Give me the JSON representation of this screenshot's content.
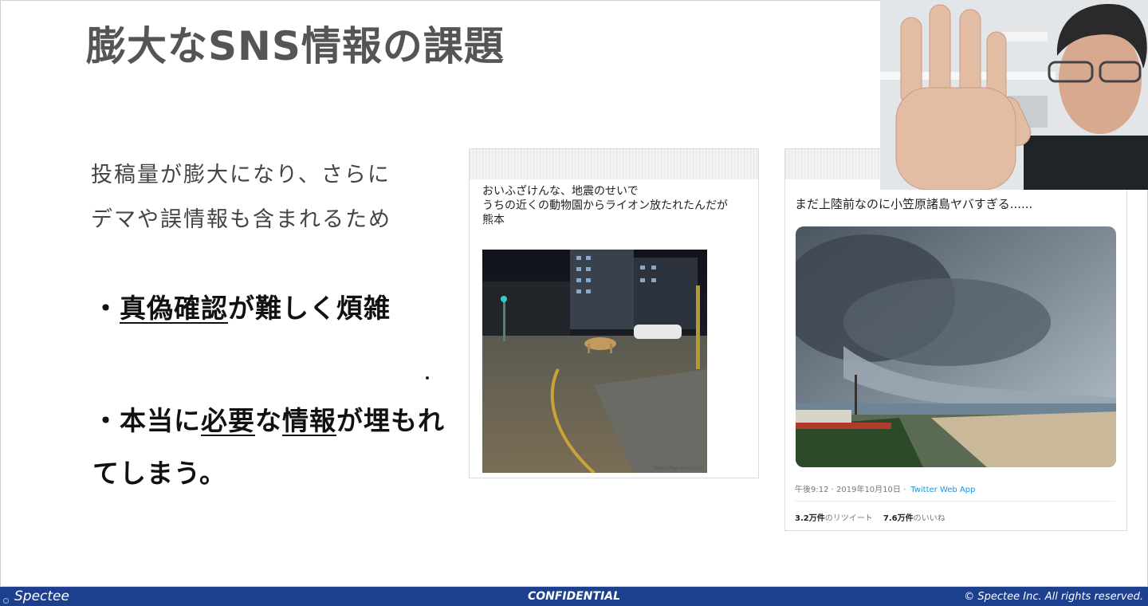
{
  "slide": {
    "title": "膨大なSNS情報の課題",
    "intro_line1": "投稿量が膨大になり、さらに",
    "intro_line2": "デマや誤情報も含まれるため",
    "bullet1": {
      "prefix": "・",
      "underlined": "真偽確認",
      "suffix": "が難しく煩雑"
    },
    "bullet2": {
      "prefix": "・本当に",
      "underlined1": "必要",
      "middle": "な",
      "underlined2": "情報",
      "suffix": "が埋もれてしまう。"
    }
  },
  "tweet1": {
    "text": "おいふざけんな、地震のせいで\nうちの近くの動物園からライオン放たれたんだが\n熊本",
    "watermark": "Twitter/Nanahoe1222",
    "photo_icon": "lion-street-night-photo"
  },
  "tweet2": {
    "text": "まだ上陸前なのに小笠原諸島ヤバすぎる......",
    "timestamp": "午後9:12 · 2019年10月10日 ·",
    "app": "Twitter Web App",
    "retweets_value": "3.2万件",
    "retweets_label": "のリツイート",
    "likes_value": "7.6万件",
    "likes_label": "のいいね",
    "photo_icon": "storm-cloud-beach-photo",
    "link_color": "#1b95e0"
  },
  "webcam": {
    "icon": "presenter-webcam-feed"
  },
  "footer": {
    "brand": "Spectee",
    "center": "CONFIDENTIAL",
    "rights": "© Spectee Inc. All rights reserved.",
    "bar_color": "#1c3f8e"
  }
}
